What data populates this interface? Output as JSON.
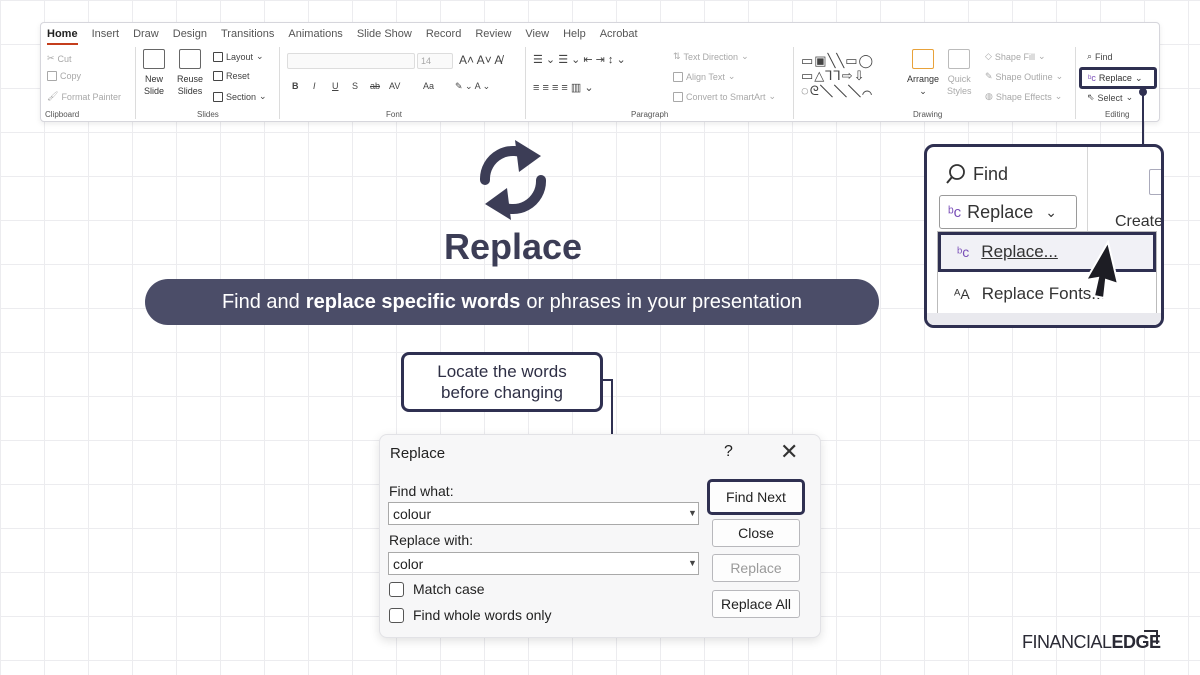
{
  "ribbon": {
    "tabs": [
      "Home",
      "Insert",
      "Draw",
      "Design",
      "Transitions",
      "Animations",
      "Slide Show",
      "Record",
      "Review",
      "View",
      "Help",
      "Acrobat"
    ],
    "active_tab": "Home",
    "clipboard": {
      "cut": "Cut",
      "copy": "Copy",
      "format_painter": "Format Painter",
      "label": "Clipboard"
    },
    "slides": {
      "new_slide_1": "New",
      "new_slide_2": "Slide",
      "reuse_1": "Reuse",
      "reuse_2": "Slides",
      "layout": "Layout",
      "reset": "Reset",
      "section": "Section",
      "label": "Slides"
    },
    "font": {
      "size": "14",
      "bold": "B",
      "italic": "I",
      "underline": "U",
      "shadow": "S",
      "strike": "ab",
      "spacing": "AV",
      "case": "Aa",
      "label": "Font"
    },
    "paragraph": {
      "text_direction": "Text Direction",
      "align_text": "Align Text",
      "convert": "Convert to SmartArt",
      "label": "Paragraph"
    },
    "drawing": {
      "arrange": "Arrange",
      "quick_styles_1": "Quick",
      "quick_styles_2": "Styles",
      "shape_fill": "Shape Fill",
      "shape_outline": "Shape Outline",
      "shape_effects": "Shape Effects",
      "label": "Drawing"
    },
    "editing": {
      "find": "Find",
      "replace": "Replace",
      "select": "Select",
      "label": "Editing"
    }
  },
  "zoom": {
    "find": "Find",
    "replace_button": "Replace",
    "create": "Create",
    "menu_replace": "Replace...",
    "menu_replace_fonts": "Replace Fonts..."
  },
  "hero": {
    "title": "Replace",
    "banner_pre": "Find and",
    "banner_bold": "replace specific words",
    "banner_post": "or phrases in your presentation"
  },
  "callout": {
    "line1": "Locate the words",
    "line2": "before changing"
  },
  "dialog": {
    "title": "Replace",
    "help": "?",
    "close": "✕",
    "find_label": "Find what:",
    "find_value": "colour",
    "replace_label": "Replace with:",
    "replace_value": "color",
    "match_case": "Match case",
    "whole_words": "Find whole words only",
    "find_next": "Find Next",
    "close_btn": "Close",
    "replace_btn": "Replace",
    "replace_all": "Replace All"
  },
  "logo": {
    "part1": "FINANCIAL",
    "part2": "EDGE"
  },
  "colors": {
    "accent": "#2f3051",
    "banner": "#4b4d68",
    "tab_underline": "#c43e1c"
  }
}
